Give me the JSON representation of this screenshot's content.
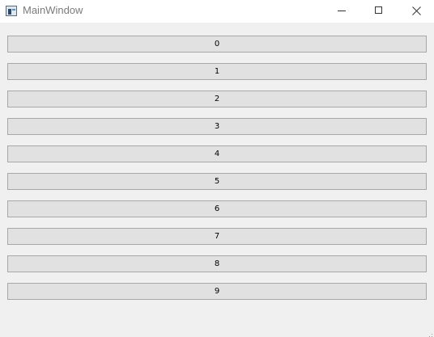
{
  "window": {
    "title": "MainWindow",
    "controls": [
      "minimize",
      "maximize",
      "close"
    ]
  },
  "buttons": [
    {
      "label": "0"
    },
    {
      "label": "1"
    },
    {
      "label": "2"
    },
    {
      "label": "3"
    },
    {
      "label": "4"
    },
    {
      "label": "5"
    },
    {
      "label": "6"
    },
    {
      "label": "7"
    },
    {
      "label": "8"
    },
    {
      "label": "9"
    }
  ],
  "icons": {
    "app": "app-window-icon",
    "minimize": "minimize-icon",
    "maximize": "maximize-icon",
    "close": "close-icon",
    "grip": "resize-grip-icon"
  },
  "colors": {
    "window_bg": "#f0f0f0",
    "titlebar_bg": "#ffffff",
    "button_bg": "#e1e1e1",
    "button_border": "#a8a8a8"
  }
}
